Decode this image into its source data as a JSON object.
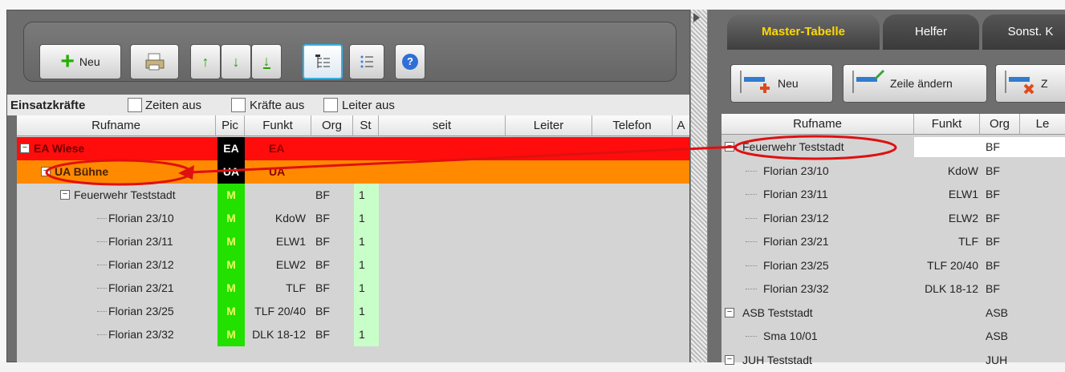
{
  "toolbar": {
    "new_label": "Neu"
  },
  "options": {
    "title": "Einsatzkräfte",
    "cb1": "Zeiten aus",
    "cb2": "Kräfte aus",
    "cb3": "Leiter aus"
  },
  "left_grid": {
    "headers": [
      "Rufname",
      "Pic",
      "Funkt",
      "Org",
      "St",
      "seit",
      "Leiter",
      "Telefon",
      "A"
    ],
    "rows": [
      {
        "name": "EA Wiese",
        "pic": "EA",
        "funkt": "EA",
        "org": "",
        "st": "",
        "style": "red",
        "indent": 0,
        "toggle": "⊟"
      },
      {
        "name": "UA Bühne",
        "pic": "UA",
        "funkt": "UA",
        "org": "",
        "st": "",
        "style": "orange",
        "indent": 1,
        "toggle": "⊟"
      },
      {
        "name": "Feuerwehr Teststadt",
        "pic": "M",
        "funkt": "",
        "org": "BF",
        "st": "1",
        "style": "plain",
        "indent": 2,
        "toggle": "⊟"
      },
      {
        "name": "Florian 23/10",
        "pic": "M",
        "funkt": "KdoW",
        "org": "BF",
        "st": "1",
        "style": "plain",
        "indent": 3,
        "toggle": ""
      },
      {
        "name": "Florian 23/11",
        "pic": "M",
        "funkt": "ELW1",
        "org": "BF",
        "st": "1",
        "style": "plain",
        "indent": 3,
        "toggle": ""
      },
      {
        "name": "Florian 23/12",
        "pic": "M",
        "funkt": "ELW2",
        "org": "BF",
        "st": "1",
        "style": "plain",
        "indent": 3,
        "toggle": ""
      },
      {
        "name": "Florian 23/21",
        "pic": "M",
        "funkt": "TLF",
        "org": "BF",
        "st": "1",
        "style": "plain",
        "indent": 3,
        "toggle": ""
      },
      {
        "name": "Florian 23/25",
        "pic": "M",
        "funkt": "TLF 20/40",
        "org": "BF",
        "st": "1",
        "style": "plain",
        "indent": 3,
        "toggle": ""
      },
      {
        "name": "Florian 23/32",
        "pic": "M",
        "funkt": "DLK 18-12",
        "org": "BF",
        "st": "1",
        "style": "plain",
        "indent": 3,
        "toggle": ""
      }
    ]
  },
  "right_tabs": [
    "Master-Tabelle",
    "Helfer",
    "Sonst. K"
  ],
  "right_buttons": {
    "new": "Neu",
    "edit": "Zeile ändern",
    "del": "Z"
  },
  "right_grid": {
    "headers": [
      "Rufname",
      "Funkt",
      "Org",
      "Le"
    ],
    "rows": [
      {
        "name": "Feuerwehr Teststadt",
        "funkt": "",
        "org": "BF",
        "indent": 0,
        "toggle": "⊟",
        "selected": true
      },
      {
        "name": "Florian 23/10",
        "funkt": "KdoW",
        "org": "BF",
        "indent": 1,
        "toggle": ""
      },
      {
        "name": "Florian 23/11",
        "funkt": "ELW1",
        "org": "BF",
        "indent": 1,
        "toggle": ""
      },
      {
        "name": "Florian 23/12",
        "funkt": "ELW2",
        "org": "BF",
        "indent": 1,
        "toggle": ""
      },
      {
        "name": "Florian 23/21",
        "funkt": "TLF",
        "org": "BF",
        "indent": 1,
        "toggle": ""
      },
      {
        "name": "Florian 23/25",
        "funkt": "TLF 20/40",
        "org": "BF",
        "indent": 1,
        "toggle": ""
      },
      {
        "name": "Florian 23/32",
        "funkt": "DLK 18-12",
        "org": "BF",
        "indent": 1,
        "toggle": ""
      },
      {
        "name": "ASB Teststadt",
        "funkt": "",
        "org": "ASB",
        "indent": 0,
        "toggle": "⊟"
      },
      {
        "name": "Sma 10/01",
        "funkt": "",
        "org": "ASB",
        "indent": 1,
        "toggle": ""
      },
      {
        "name": "JUH Teststadt",
        "funkt": "",
        "org": "JUH",
        "indent": 0,
        "toggle": "⊟"
      }
    ]
  },
  "colors": {
    "accent_tab": "#ffd800",
    "red": "#ff0d0d",
    "orange": "#ff8a00",
    "pic_green": "#22e000",
    "st_green": "#c8ffc8"
  }
}
